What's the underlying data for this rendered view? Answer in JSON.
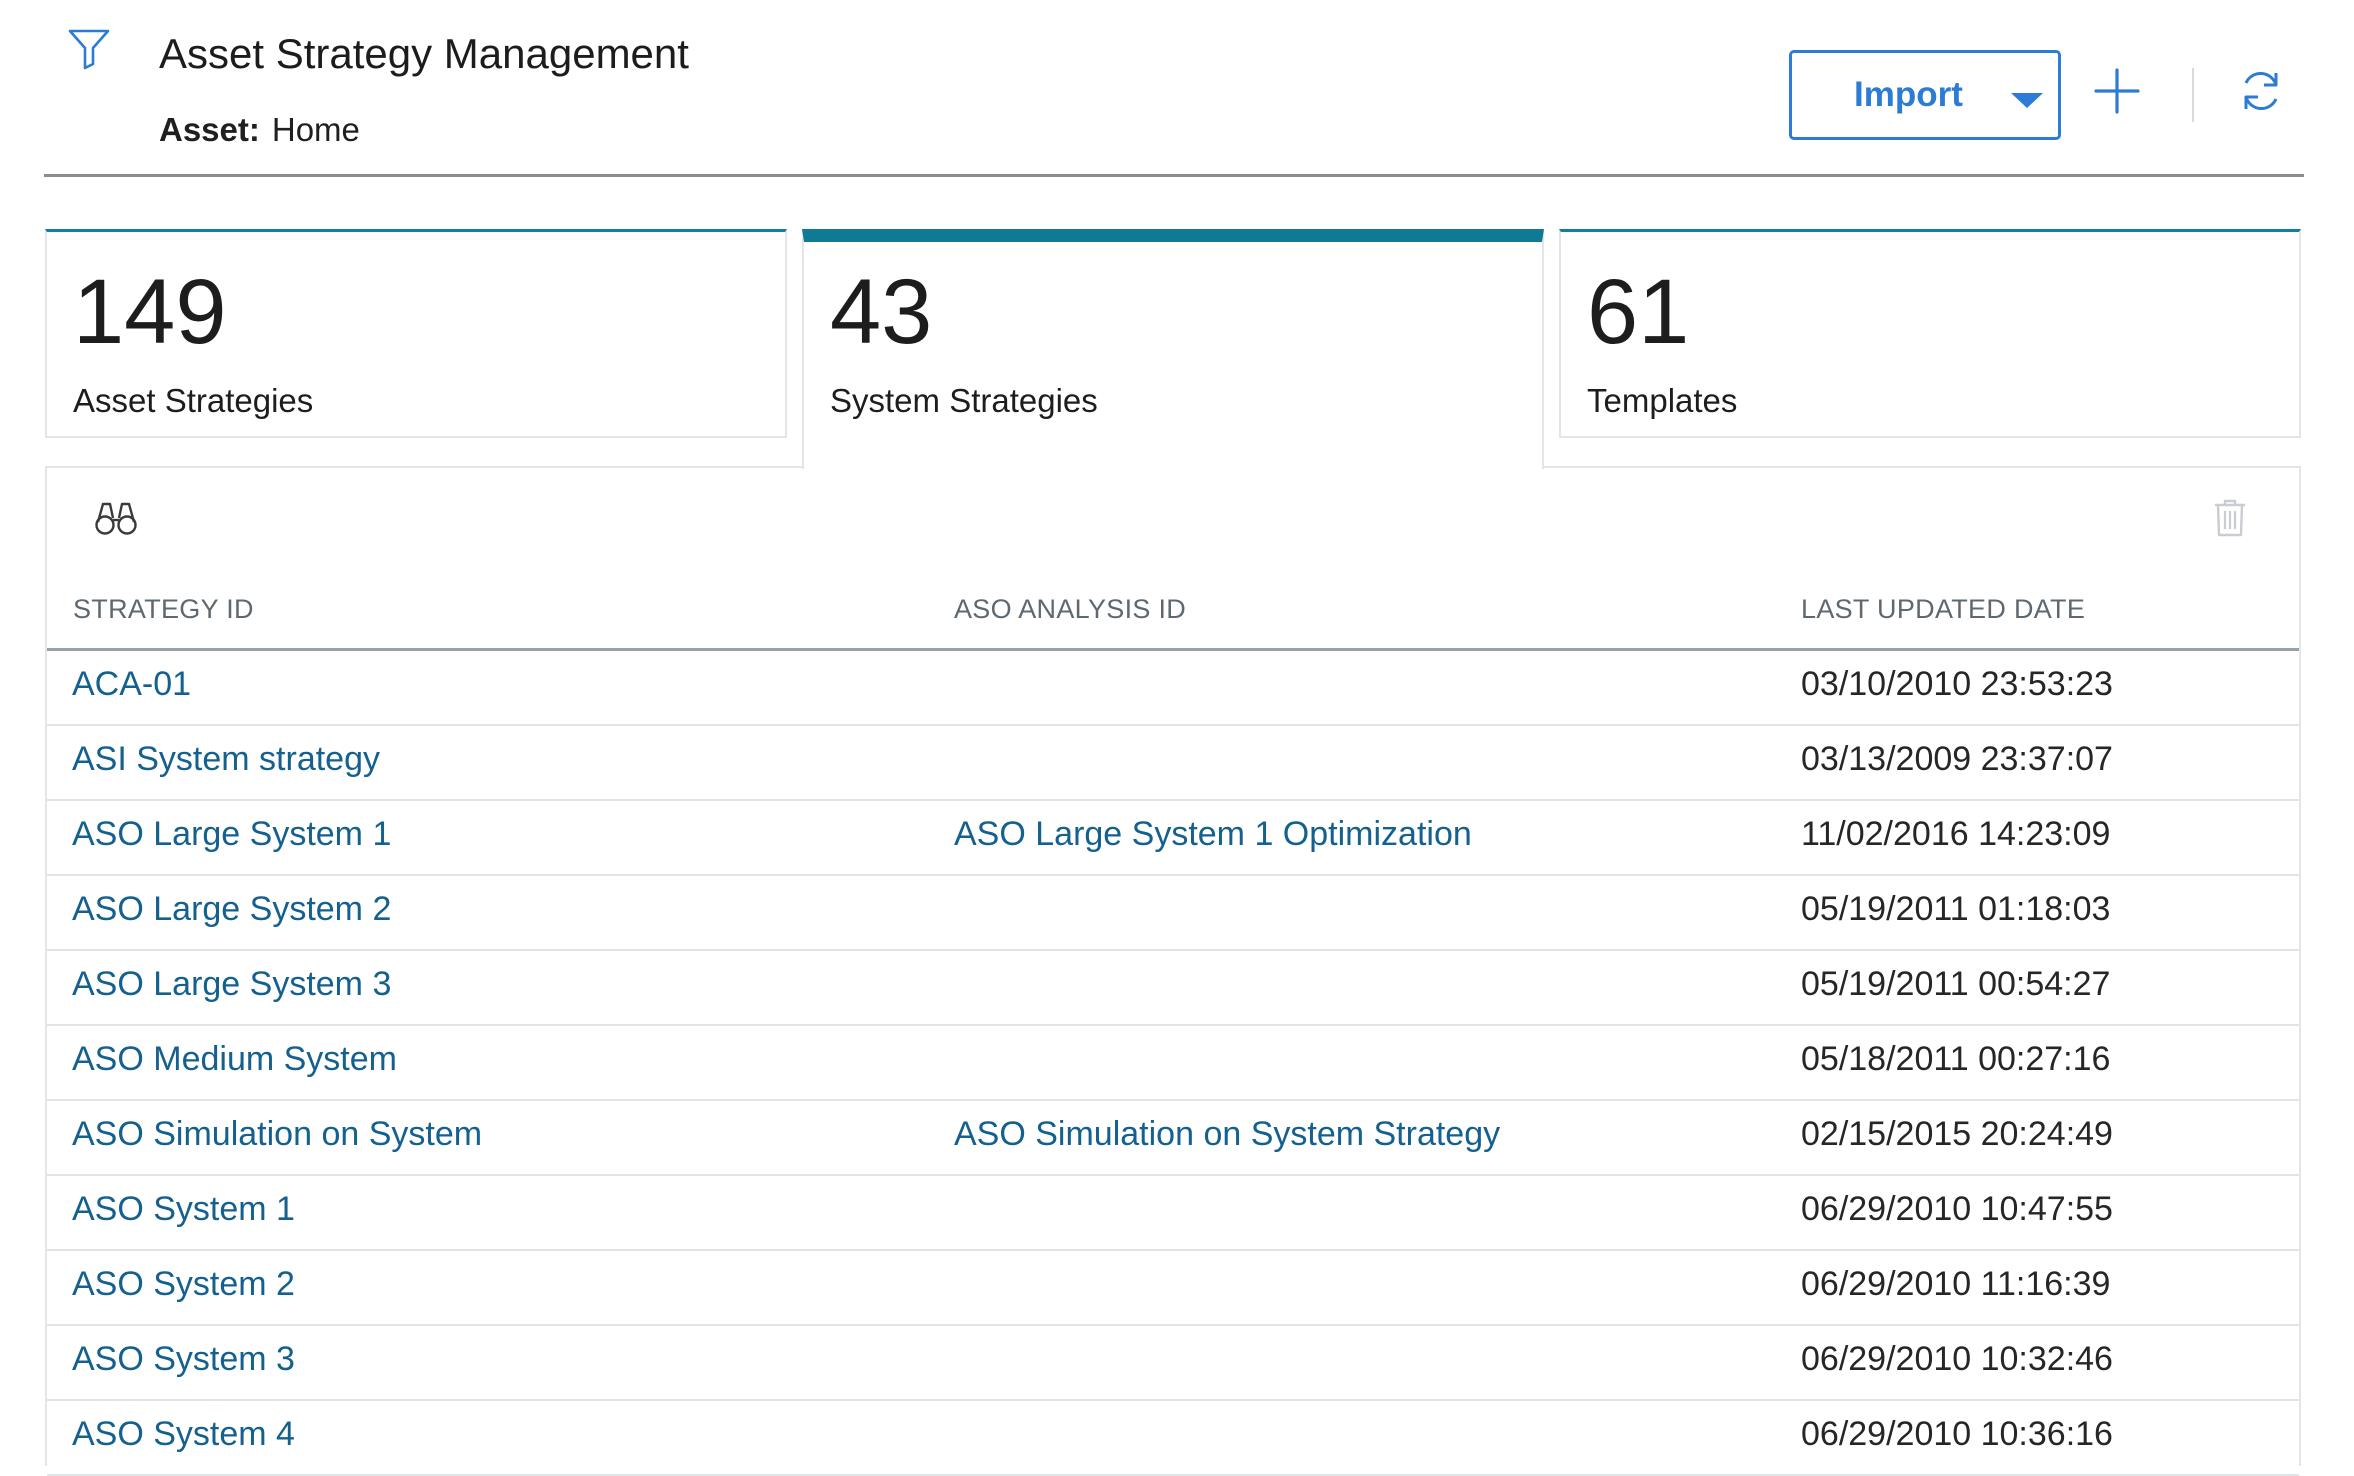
{
  "header": {
    "title": "Asset Strategy Management",
    "asset_label": "Asset:",
    "asset_value": "Home",
    "import_label": "Import",
    "filter_icon": "filter-icon",
    "add_icon": "plus-icon",
    "refresh_icon": "refresh-icon"
  },
  "colors": {
    "accent": "#2c7bd5",
    "link": "#14608f",
    "active_tab": "#0f7a93"
  },
  "cards": [
    {
      "count": "149",
      "label": "Asset Strategies",
      "active": false
    },
    {
      "count": "43",
      "label": "System Strategies",
      "active": true
    },
    {
      "count": "61",
      "label": "Templates",
      "active": false
    }
  ],
  "table": {
    "toolbar_icons": [
      "binoculars-icon",
      "trash-icon"
    ],
    "columns": [
      "STRATEGY ID",
      "ASO ANALYSIS ID",
      "LAST UPDATED DATE"
    ],
    "rows": [
      {
        "strategy_id": "ACA-01",
        "aso_analysis_id": "",
        "last_updated": "03/10/2010 23:53:23"
      },
      {
        "strategy_id": "ASI System strategy",
        "aso_analysis_id": "",
        "last_updated": "03/13/2009 23:37:07"
      },
      {
        "strategy_id": "ASO Large System 1",
        "aso_analysis_id": "ASO Large System 1 Optimization",
        "last_updated": "11/02/2016 14:23:09"
      },
      {
        "strategy_id": "ASO Large System 2",
        "aso_analysis_id": "",
        "last_updated": "05/19/2011 01:18:03"
      },
      {
        "strategy_id": "ASO Large System 3",
        "aso_analysis_id": "",
        "last_updated": "05/19/2011 00:54:27"
      },
      {
        "strategy_id": "ASO Medium System",
        "aso_analysis_id": "",
        "last_updated": "05/18/2011 00:27:16"
      },
      {
        "strategy_id": "ASO Simulation on System",
        "aso_analysis_id": "ASO Simulation on System Strategy",
        "last_updated": "02/15/2015 20:24:49"
      },
      {
        "strategy_id": "ASO System 1",
        "aso_analysis_id": "",
        "last_updated": "06/29/2010 10:47:55"
      },
      {
        "strategy_id": "ASO System 2",
        "aso_analysis_id": "",
        "last_updated": "06/29/2010 11:16:39"
      },
      {
        "strategy_id": "ASO System 3",
        "aso_analysis_id": "",
        "last_updated": "06/29/2010 10:32:46"
      },
      {
        "strategy_id": "ASO System 4",
        "aso_analysis_id": "",
        "last_updated": "06/29/2010 10:36:16"
      }
    ]
  }
}
